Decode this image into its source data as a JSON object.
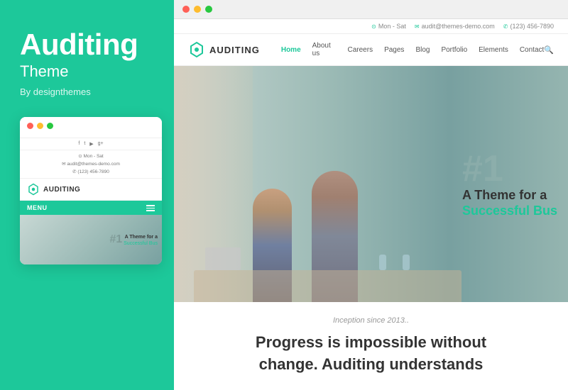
{
  "left": {
    "title": "Auditing",
    "subtitle": "Theme",
    "by": "By designthemes"
  },
  "mobile": {
    "traffic_lights": [
      "red",
      "yellow",
      "green"
    ],
    "topbar_text": "Mon - Sat   audit@themes-demo.com   (123) 456-7890",
    "social_icons": [
      "f",
      "t",
      "yt",
      "g+"
    ],
    "info_lines": [
      "Mon - Sat",
      "audit@themes-demo.com",
      "(123) 456-7890"
    ],
    "logo_text": "AUDITING",
    "menu_label": "MENU",
    "hero_number": "#1",
    "hero_text": "A Theme for a",
    "hero_accent": "Successful Bus"
  },
  "browser": {
    "traffic_lights": [
      "red",
      "yellow",
      "green"
    ]
  },
  "site": {
    "topbar": {
      "schedule": "Mon - Sat",
      "email": "audit@themes-demo.com",
      "phone": "(123) 456-7890"
    },
    "nav": {
      "logo_text": "AUDITING",
      "links": [
        "Home",
        "About us",
        "Careers",
        "Pages",
        "Blog",
        "Portfolio",
        "Elements",
        "Contact"
      ]
    },
    "hero": {
      "number": "#1",
      "tagline_line1": "A Theme for a",
      "tagline_line2": "Successful Bus"
    },
    "below": {
      "inception": "Inception since 2013..",
      "headline_line1": "Progress is impossible without",
      "headline_line2": "change. Auditing understands"
    }
  }
}
